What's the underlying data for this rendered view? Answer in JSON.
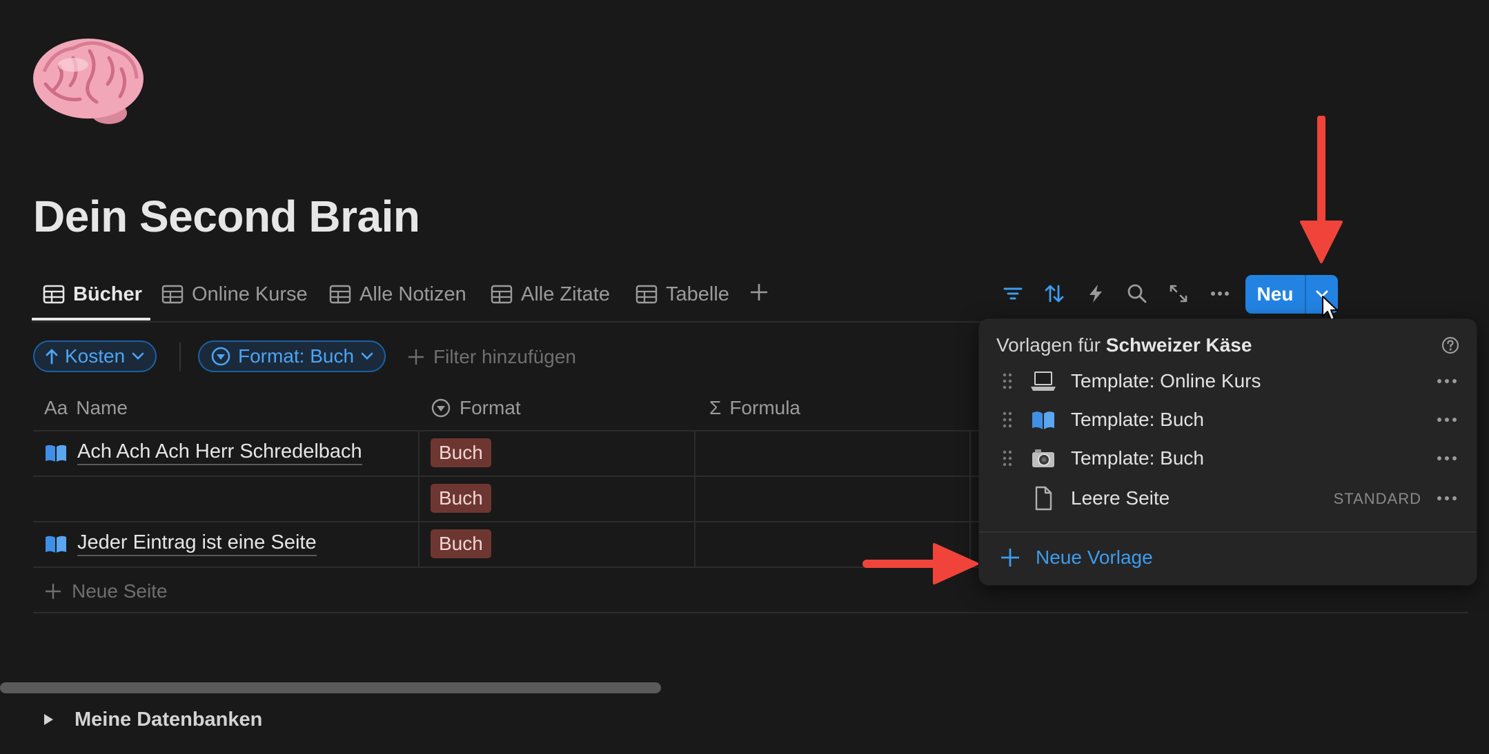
{
  "page": {
    "icon": "brain-emoji",
    "title": "Dein Second Brain"
  },
  "tabs": [
    {
      "label": "Bücher",
      "icon": "table-icon",
      "active": true
    },
    {
      "label": "Online Kurse",
      "icon": "table-icon",
      "active": false
    },
    {
      "label": "Alle Notizen",
      "icon": "table-icon",
      "active": false
    },
    {
      "label": "Alle Zitate",
      "icon": "table-icon",
      "active": false
    },
    {
      "label": "Tabelle",
      "icon": "table-icon",
      "active": false
    }
  ],
  "toolbar": {
    "icons": [
      "filter-icon",
      "sort-icon",
      "lightning-icon",
      "search-icon",
      "expand-icon",
      "more-icon"
    ],
    "new_label": "Neu",
    "accent": "#2383e2"
  },
  "filters": {
    "sort_chip": "Kosten",
    "format_chip": "Format: Buch",
    "add_filter": "Filter hinzufügen"
  },
  "table": {
    "columns": [
      {
        "icon_text": "Aa",
        "label": "Name"
      },
      {
        "icon": "select-icon",
        "label": "Format"
      },
      {
        "icon_text": "Σ",
        "label": "Formula"
      }
    ],
    "rows": [
      {
        "name": "Ach Ach Ach Herr Schredelbach",
        "icon": "book-icon",
        "format": "Buch"
      },
      {
        "name": "",
        "icon": "",
        "format": "Buch"
      },
      {
        "name": "Jeder Eintrag ist eine Seite",
        "icon": "book-icon",
        "format": "Buch"
      }
    ],
    "new_page": "Neue Seite",
    "tag_color": "#6e3630"
  },
  "toggle": {
    "label": "Meine Datenbanken"
  },
  "dropdown": {
    "header_prefix": "Vorlagen für",
    "header_db": "Schweizer Käse",
    "items": [
      {
        "label": "Template: Online Kurs",
        "icon": "laptop-icon",
        "badge": ""
      },
      {
        "label": "Template: Buch",
        "icon": "book-icon",
        "badge": ""
      },
      {
        "label": "Template: Buch",
        "icon": "camera-icon",
        "badge": ""
      },
      {
        "label": "Leere Seite",
        "icon": "page-icon",
        "badge": "STANDARD"
      }
    ],
    "new_template": "Neue Vorlage"
  },
  "annotations": {
    "arrow_color": "#f0443a"
  }
}
